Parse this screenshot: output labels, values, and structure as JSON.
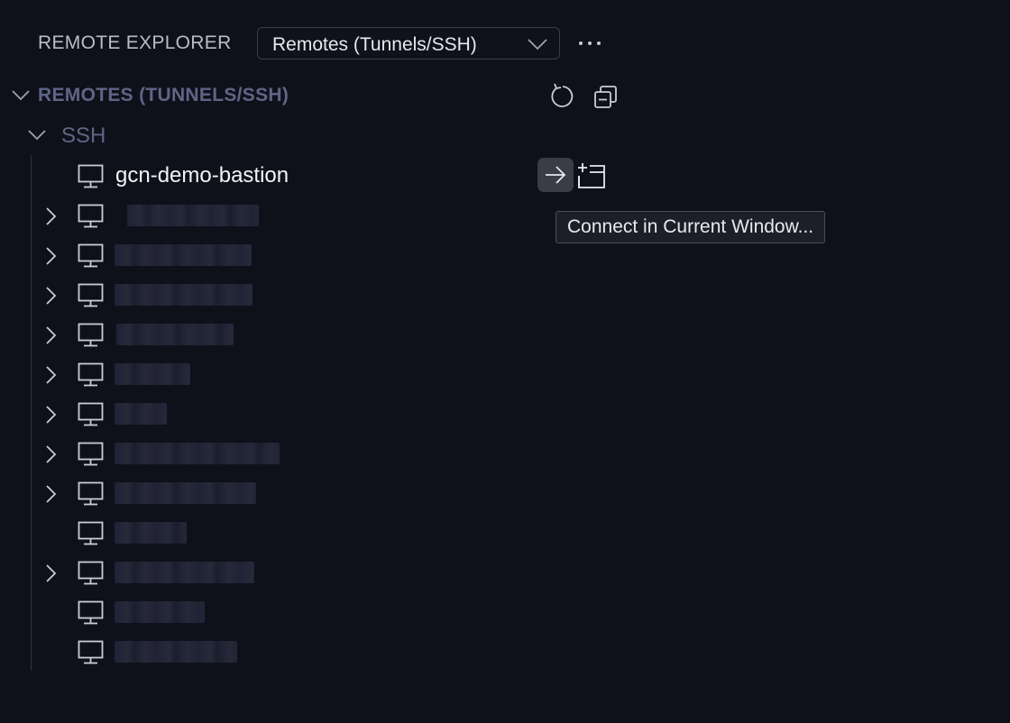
{
  "header": {
    "title": "REMOTE EXPLORER",
    "dropdown_value": "Remotes (Tunnels/SSH)",
    "more_icon": "ellipsis-icon"
  },
  "section": {
    "title": "REMOTES (TUNNELS/SSH)",
    "actions": [
      "refresh-icon",
      "collapse-all-icon"
    ]
  },
  "ssh_group": {
    "label": "SSH",
    "hosts": [
      {
        "label": "gcn-demo-bastion",
        "expandable": false,
        "redacted": false
      },
      {
        "label": "",
        "expandable": true,
        "redacted": true
      },
      {
        "label": "",
        "expandable": true,
        "redacted": true
      },
      {
        "label": "",
        "expandable": true,
        "redacted": true
      },
      {
        "label": "",
        "expandable": true,
        "redacted": true
      },
      {
        "label": "",
        "expandable": true,
        "redacted": true
      },
      {
        "label": "",
        "expandable": true,
        "redacted": true
      },
      {
        "label": "",
        "expandable": true,
        "redacted": true
      },
      {
        "label": "",
        "expandable": true,
        "redacted": true
      },
      {
        "label": "",
        "expandable": false,
        "redacted": true
      },
      {
        "label": "",
        "expandable": true,
        "redacted": true
      },
      {
        "label": "",
        "expandable": false,
        "redacted": true
      },
      {
        "label": "",
        "expandable": false,
        "redacted": true
      }
    ]
  },
  "hover_actions": {
    "connect_icon": "arrow-right-icon",
    "new_window_icon": "new-window-icon"
  },
  "tooltip": {
    "text": "Connect in Current Window..."
  },
  "colors": {
    "background": "#0f111a",
    "muted_header": "#5f6586",
    "hover_button": "#3a3c47"
  }
}
